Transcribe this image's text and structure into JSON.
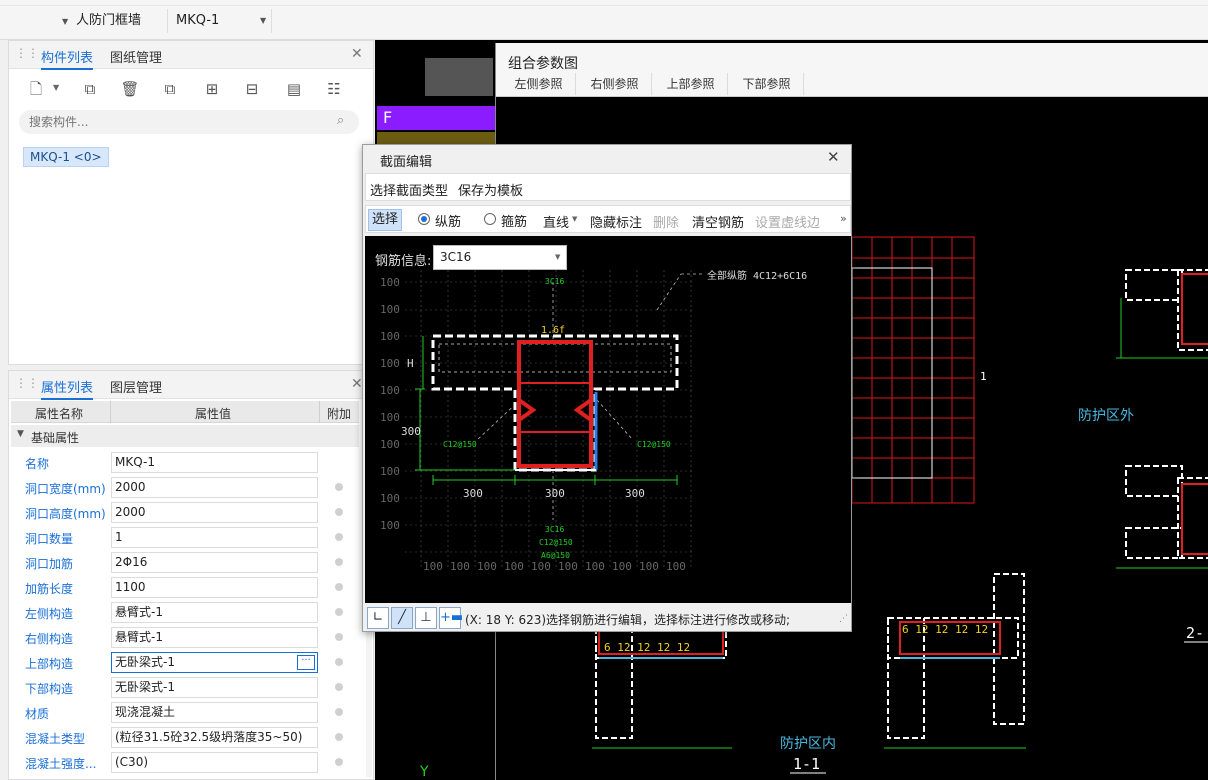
{
  "topbar": {
    "category": "人防门框墙",
    "component": "MKQ-1"
  },
  "component_panel": {
    "tabs": [
      "构件列表",
      "图纸管理"
    ],
    "search_placeholder": "搜索构件...",
    "items": [
      "MKQ-1 <0>"
    ]
  },
  "property_panel": {
    "tabs": [
      "属性列表",
      "图层管理"
    ],
    "headers": [
      "属性名称",
      "属性值",
      "附加"
    ],
    "group": "基础属性",
    "rows": [
      {
        "name": "名称",
        "value": "MKQ-1"
      },
      {
        "name": "洞口宽度(mm)",
        "value": "2000"
      },
      {
        "name": "洞口高度(mm)",
        "value": "2000"
      },
      {
        "name": "洞口数量",
        "value": "1"
      },
      {
        "name": "洞口加筋",
        "value": "2Φ16"
      },
      {
        "name": "加筋长度",
        "value": "1100"
      },
      {
        "name": "左侧构造",
        "value": "悬臂式-1"
      },
      {
        "name": "右侧构造",
        "value": "悬臂式-1"
      },
      {
        "name": "上部构造",
        "value": "无卧梁式-1"
      },
      {
        "name": "下部构造",
        "value": "无卧梁式-1"
      },
      {
        "name": "材质",
        "value": "现浇混凝土"
      },
      {
        "name": "混凝土类型",
        "value": "(粒径31.5砼32.5级坍落度35~50)"
      },
      {
        "name": "混凝土强度...",
        "value": "(C30)"
      }
    ]
  },
  "combo": {
    "title": "组合参数图",
    "buttons": [
      "左侧参照",
      "右侧参照",
      "上部参照",
      "下部参照"
    ],
    "labels": {
      "outside": "防护区外",
      "inside": "防护区内",
      "section_1": "1-1",
      "section_2": "2-",
      "marker_1": "1",
      "marker_f": "F",
      "marker_y": "Y"
    }
  },
  "dialog": {
    "title": "截面编辑",
    "menu": [
      "选择截面类型",
      "保存为模板"
    ],
    "toolbar": {
      "select": "选择",
      "radio_long": "纵筋",
      "radio_stirrup": "箍筋",
      "line": "直线",
      "hide_label": "隐藏标注",
      "delete": "删除",
      "clear": "清空钢筋",
      "set_edge": "设置虚线边",
      "more": "»"
    },
    "rebar_label": "钢筋信息:",
    "rebar_value": "3C16",
    "status": "(X: 18 Y: 623)选择钢筋进行编辑，选择标注进行修改或移动;",
    "drawing": {
      "all_rebar": "全部纵筋  4C12+6C16",
      "top_rebar": "3C16",
      "bottom_rebar": "3C16",
      "stirrup_left": "C12@150",
      "stirrup_right": "C12@150",
      "stirrup_bottom": "C12@150",
      "stirrup_a": "A6@150",
      "label_h": "H",
      "dim_300": "300",
      "left_dim": "300",
      "mid_label": "1.6f",
      "grid": "100"
    }
  },
  "colors": {
    "accent": "#1a6fd6",
    "cad_bg": "#000000",
    "rebar_red": "#e02020",
    "dim_green": "#22cc22",
    "outline_white": "#ffffff",
    "grid_red": "#d81818",
    "cad_cyan": "#4ab8e0",
    "cad_yellow": "#f0d020",
    "magenta": "#8a1cff"
  }
}
